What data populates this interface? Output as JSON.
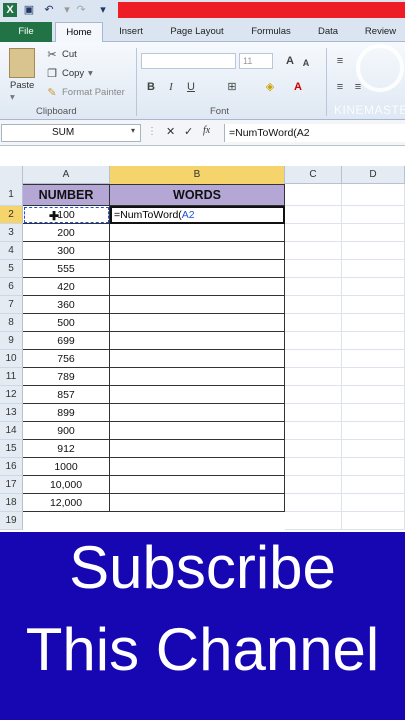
{
  "title_bar": {
    "qat_icons": [
      "excel-logo-icon",
      "save-icon",
      "undo-icon",
      "redo-icon",
      "customize-icon"
    ]
  },
  "ribbon": {
    "tabs": [
      "File",
      "Home",
      "Insert",
      "Page Layout",
      "Formulas",
      "Data",
      "Review"
    ],
    "active_tab": "Home",
    "clipboard": {
      "paste": "Paste",
      "cut": "Cut",
      "copy": "Copy",
      "format_painter": "Format Painter",
      "group_label": "Clipboard"
    },
    "font": {
      "size": "11",
      "group_label": "Font",
      "bold": "B",
      "italic": "I",
      "underline": "U",
      "grow": "A",
      "shrink": "A"
    }
  },
  "watermark": "KINEMASTER",
  "formula_bar": {
    "name_box": "SUM",
    "cancel": "✕",
    "enter": "✓",
    "fx": "fx",
    "formula": "=NumToWord(A2"
  },
  "columns": [
    "A",
    "B",
    "C",
    "D"
  ],
  "rows": [
    "1",
    "2",
    "3",
    "4",
    "5",
    "6",
    "7",
    "8",
    "9",
    "10",
    "11",
    "12",
    "13",
    "14",
    "15",
    "16",
    "17",
    "18",
    "19"
  ],
  "headers": {
    "a1": "NUMBER",
    "b1": "WORDS"
  },
  "numbers": [
    "100",
    "200",
    "300",
    "555",
    "420",
    "360",
    "500",
    "699",
    "756",
    "789",
    "857",
    "899",
    "900",
    "912",
    "1000",
    "10,000",
    "12,000"
  ],
  "editing_cell": {
    "prefix": "=NumToWord(",
    "ref": "A2"
  },
  "banner": {
    "line1": "Subscribe",
    "line2": "This Channel"
  },
  "colors": {
    "file_tab": "#217346",
    "header_fill": "#b4a7d6",
    "banner": "#1707b2",
    "ref_blue": "#1f4fd6"
  }
}
